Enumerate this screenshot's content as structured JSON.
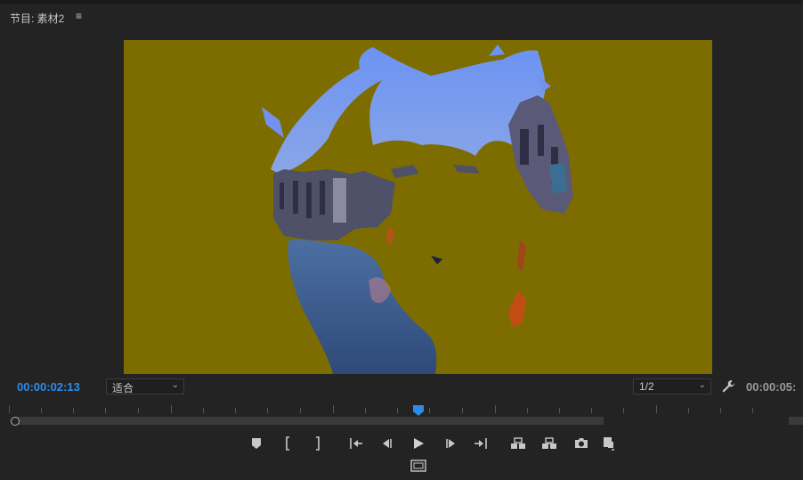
{
  "panel": {
    "title": "节目: 素材2",
    "menu_icon": "≡"
  },
  "viewer": {
    "background_color": "#7d6d00",
    "content": "posterized portrait over Venice canal footage"
  },
  "controls": {
    "current_timecode": "00:00:02:13",
    "duration_timecode": "00:00:05:",
    "zoom": {
      "selected": "适合",
      "icon": "chevron-down-icon"
    },
    "resolution": {
      "selected": "1/2",
      "icon": "chevron-down-icon"
    },
    "settings_icon": "wrench-icon"
  },
  "timeline": {
    "playhead_position": 0.526,
    "playhead_color": "#2d8ceb"
  },
  "transport": {
    "buttons": [
      "add-marker",
      "mark-in",
      "mark-out",
      "go-to-in",
      "step-back",
      "play",
      "step-forward",
      "go-to-out",
      "lift",
      "extract",
      "export-frame",
      "button-editor"
    ],
    "bottom_button": "safe-margins"
  },
  "colors": {
    "accent": "#2d8ceb",
    "panel_bg": "#232323"
  }
}
